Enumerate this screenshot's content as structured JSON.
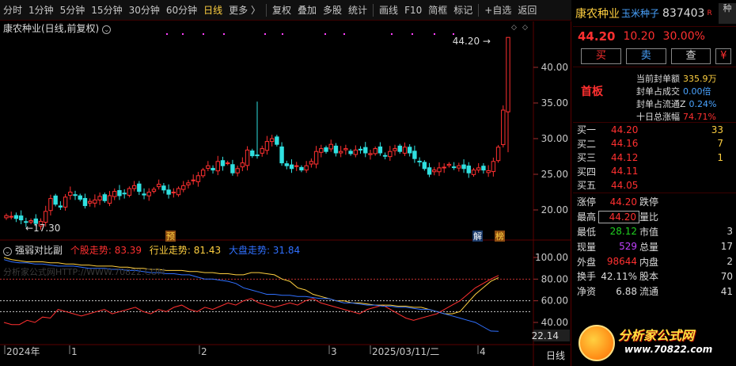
{
  "toolbar": {
    "items": [
      "分时",
      "1分钟",
      "5分钟",
      "15分钟",
      "30分钟",
      "60分钟",
      "日线",
      "更多 〉",
      "复权",
      "叠加",
      "多股",
      "统计",
      "画线",
      "F10",
      "简框",
      "标记",
      "+自选",
      "返回"
    ],
    "active_index": 6
  },
  "chart": {
    "title": "康农种业(日线,前复权)",
    "high_label": "44.20",
    "low_label": "17.30",
    "y_ticks": [
      "40.00",
      "35.00",
      "30.00",
      "25.00",
      "20.00"
    ],
    "markers": [
      "预",
      "解",
      "榜"
    ],
    "x_labels": [
      "2024年",
      "1",
      "2",
      "3",
      "2025/03/11/二",
      "4"
    ],
    "bottom_value": "22.14",
    "bottom_label": "日线"
  },
  "indicator": {
    "name": "强弱对比副",
    "items": [
      {
        "label": "个股走势: 83.39",
        "color": "#ff3030"
      },
      {
        "label": "行业走势: 81.43",
        "color": "#ffd040"
      },
      {
        "label": "大盘走势: 31.84",
        "color": "#3070ff"
      }
    ],
    "watermark": "分析家公式网HTTP://WWW.70822.COM",
    "y_ticks": [
      "100.00",
      "80.00",
      "60.00",
      "40.00"
    ]
  },
  "panel": {
    "name": "康农种业",
    "concept": "玉米种子",
    "code": "837403",
    "r_mark": "R",
    "extra_tab": "种",
    "price": "44.20",
    "change": "10.20",
    "pct": "30.00%",
    "buttons": [
      "买",
      "卖",
      "查"
    ],
    "seal": {
      "tag": "首板",
      "rows": [
        {
          "k": "当前封单额",
          "v": "335.9万",
          "c": "#ffd040"
        },
        {
          "k": "封单占成交",
          "v": "0.00倍",
          "c": "#4aa3ff"
        },
        {
          "k": "封单占流通Z",
          "v": "0.24%",
          "c": "#4aa3ff"
        },
        {
          "k": "十日总涨幅",
          "v": "74.71%",
          "c": "#ff3030"
        }
      ]
    },
    "book": [
      {
        "l": "买一",
        "p": "44.20",
        "q": "33"
      },
      {
        "l": "买二",
        "p": "44.16",
        "q": "7"
      },
      {
        "l": "买三",
        "p": "44.12",
        "q": "1"
      },
      {
        "l": "买四",
        "p": "44.11",
        "q": ""
      },
      {
        "l": "买五",
        "p": "44.05",
        "q": ""
      }
    ],
    "stats": [
      {
        "k": "涨停",
        "v": "44.20",
        "vc": "#ff3030",
        "k2": "跌停",
        "v2": ""
      },
      {
        "k": "最高",
        "v": "44.20",
        "vc": "#ff3030",
        "k2": "量比",
        "v2": ""
      },
      {
        "k": "最低",
        "v": "28.12",
        "vc": "#20d020",
        "k2": "市值",
        "v2": "3"
      },
      {
        "k": "现量",
        "v": "529",
        "vc": "#c040ff",
        "k2": "总量",
        "v2": "17"
      },
      {
        "k": "外盘",
        "v": "98644",
        "vc": "#ff3030",
        "k2": "内盘",
        "v2": "2"
      },
      {
        "k": "换手",
        "v": "42.11%",
        "vc": "#dcdcdc",
        "k2": "股本",
        "v2": "70"
      },
      {
        "k": "净资",
        "v": "6.88",
        "vc": "#dcdcdc",
        "k2": "流通",
        "v2": "41"
      }
    ]
  },
  "logo": {
    "main": "分析家公式网",
    "url": "www.70822.com"
  }
}
